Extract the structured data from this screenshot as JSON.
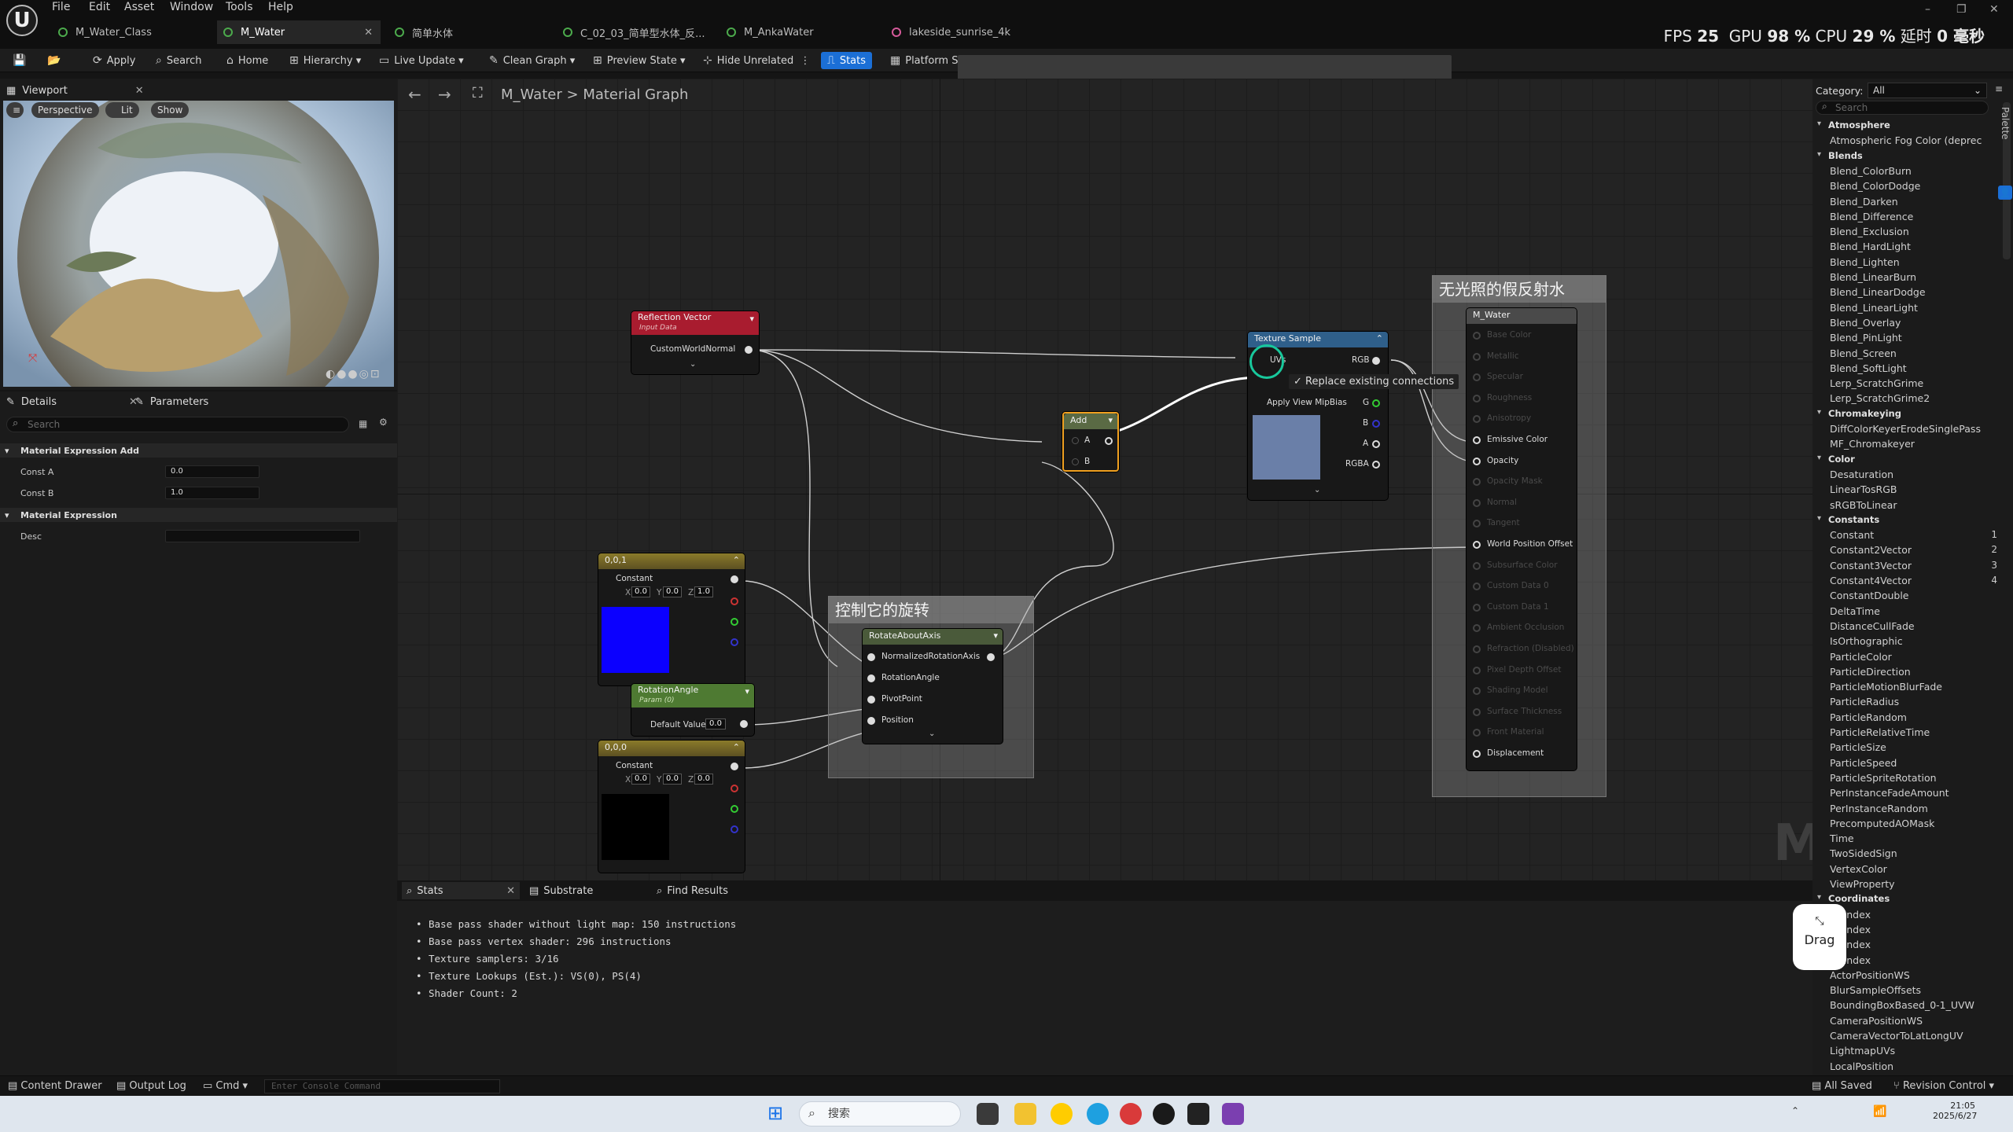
{
  "menu": [
    "File",
    "Edit",
    "Asset",
    "Window",
    "Tools",
    "Help"
  ],
  "tabs": [
    {
      "label": "M_Water_Class",
      "icon": "material-icon"
    },
    {
      "label": "M_Water",
      "icon": "material-icon",
      "active": true
    },
    {
      "label": "简单水体",
      "icon": "material-icon"
    },
    {
      "label": "C_02_03_简单型水体_反...",
      "icon": "material-icon"
    },
    {
      "label": "M_AnkaWater",
      "icon": "material-icon"
    },
    {
      "label": "lakeside_sunrise_4k",
      "icon": "texture-icon"
    }
  ],
  "perf": {
    "fps_label": "FPS",
    "fps": "25",
    "gpu_label": "GPU",
    "gpu": "98 %",
    "cpu_label": "CPU",
    "cpu": "29 %",
    "lat_label": "延时",
    "lat": "0 毫秒"
  },
  "toolbar": {
    "apply": "Apply",
    "search": "Search",
    "home": "Home",
    "hierarchy": "Hierarchy",
    "live_update": "Live Update",
    "clean_graph": "Clean Graph",
    "preview_state": "Preview State",
    "hide_unrelated": "Hide Unrelated",
    "stats": "Stats",
    "platform_stats": "Platform S"
  },
  "viewport": {
    "tab": "Viewport",
    "perspective": "Perspective",
    "lit": "Lit",
    "show": "Show"
  },
  "details": {
    "tab": "Details",
    "params_tab": "Parameters",
    "search_placeholder": "Search",
    "section1": "Material Expression Add",
    "const_a_label": "Const A",
    "const_a": "0.0",
    "const_b_label": "Const B",
    "const_b": "1.0",
    "section2": "Material Expression",
    "desc_label": "Desc"
  },
  "breadcrumb": {
    "root": "M_Water",
    "sep": ">",
    "leaf": "Material Graph"
  },
  "nodes": {
    "reflection": {
      "title": "Reflection Vector",
      "sub": "Input Data",
      "out": "CustomWorldNormal"
    },
    "add": {
      "title": "Add",
      "a": "A",
      "b": "B"
    },
    "texture": {
      "title": "Texture Sample",
      "uvs": "UVs",
      "rgb": "RGB",
      "g": "G",
      "b": "B",
      "a": "A",
      "rgba": "RGBA",
      "mip": "Apply View MipBias",
      "tooltip": "Replace existing connections"
    },
    "const001": {
      "title": "0,0,1",
      "label": "Constant",
      "x": "0.0",
      "y": "0.0",
      "z": "1.0",
      "color": "#0b00ff"
    },
    "rotangle": {
      "title": "RotationAngle",
      "sub": "Param (0)",
      "label": "Default Value",
      "val": "0.0"
    },
    "const000": {
      "title": "0,0,0",
      "label": "Constant",
      "x": "0.0",
      "y": "0.0",
      "z": "0.0",
      "color": "#000000"
    },
    "rotate": {
      "title": "RotateAboutAxis",
      "pins": [
        "NormalizedRotationAxis",
        "RotationAngle",
        "PivotPoint",
        "Position"
      ]
    }
  },
  "comments": {
    "rotation": "控制它的旋转",
    "unlit": "无光照的假反射水"
  },
  "result": {
    "title": "M_Water",
    "pins": [
      {
        "label": "Base Color",
        "active": false
      },
      {
        "label": "Metallic",
        "active": false
      },
      {
        "label": "Specular",
        "active": false
      },
      {
        "label": "Roughness",
        "active": false
      },
      {
        "label": "Anisotropy",
        "active": false
      },
      {
        "label": "Emissive Color",
        "active": true
      },
      {
        "label": "Opacity",
        "active": true
      },
      {
        "label": "Opacity Mask",
        "active": false
      },
      {
        "label": "Normal",
        "active": false
      },
      {
        "label": "Tangent",
        "active": false
      },
      {
        "label": "World Position Offset",
        "active": true
      },
      {
        "label": "Subsurface Color",
        "active": false
      },
      {
        "label": "Custom Data 0",
        "active": false
      },
      {
        "label": "Custom Data 1",
        "active": false
      },
      {
        "label": "Ambient Occlusion",
        "active": false
      },
      {
        "label": "Refraction (Disabled)",
        "active": false
      },
      {
        "label": "Pixel Depth Offset",
        "active": false
      },
      {
        "label": "Shading Model",
        "active": false
      },
      {
        "label": "Surface Thickness",
        "active": false
      },
      {
        "label": "Front Material",
        "active": false
      },
      {
        "label": "Displacement",
        "active": true
      }
    ]
  },
  "watermark": "M",
  "palette": {
    "category_label": "Category:",
    "category": "All",
    "search_placeholder": "Search",
    "side_tab": "Palette",
    "rows": [
      {
        "t": "c",
        "text": "Atmosphere"
      },
      {
        "t": "i",
        "text": "Atmospheric Fog Color (deprec"
      },
      {
        "t": "c",
        "text": "Blends"
      },
      {
        "t": "i",
        "text": "Blend_ColorBurn"
      },
      {
        "t": "i",
        "text": "Blend_ColorDodge"
      },
      {
        "t": "i",
        "text": "Blend_Darken"
      },
      {
        "t": "i",
        "text": "Blend_Difference"
      },
      {
        "t": "i",
        "text": "Blend_Exclusion"
      },
      {
        "t": "i",
        "text": "Blend_HardLight"
      },
      {
        "t": "i",
        "text": "Blend_Lighten"
      },
      {
        "t": "i",
        "text": "Blend_LinearBurn"
      },
      {
        "t": "i",
        "text": "Blend_LinearDodge"
      },
      {
        "t": "i",
        "text": "Blend_LinearLight"
      },
      {
        "t": "i",
        "text": "Blend_Overlay"
      },
      {
        "t": "i",
        "text": "Blend_PinLight"
      },
      {
        "t": "i",
        "text": "Blend_Screen"
      },
      {
        "t": "i",
        "text": "Blend_SoftLight"
      },
      {
        "t": "i",
        "text": "Lerp_ScratchGrime"
      },
      {
        "t": "i",
        "text": "Lerp_ScratchGrime2"
      },
      {
        "t": "c",
        "text": "Chromakeying"
      },
      {
        "t": "i",
        "text": "DiffColorKeyerErodeSinglePass"
      },
      {
        "t": "i",
        "text": "MF_Chromakeyer"
      },
      {
        "t": "c",
        "text": "Color"
      },
      {
        "t": "i",
        "text": "Desaturation"
      },
      {
        "t": "i",
        "text": "LinearTosRGB"
      },
      {
        "t": "i",
        "text": "sRGBToLinear"
      },
      {
        "t": "c",
        "text": "Constants"
      },
      {
        "t": "i",
        "text": "Constant",
        "n": "1"
      },
      {
        "t": "i",
        "text": "Constant2Vector",
        "n": "2"
      },
      {
        "t": "i",
        "text": "Constant3Vector",
        "n": "3"
      },
      {
        "t": "i",
        "text": "Constant4Vector",
        "n": "4"
      },
      {
        "t": "i",
        "text": "ConstantDouble"
      },
      {
        "t": "i",
        "text": "DeltaTime"
      },
      {
        "t": "i",
        "text": "DistanceCullFade"
      },
      {
        "t": "i",
        "text": "IsOrthographic"
      },
      {
        "t": "i",
        "text": "ParticleColor"
      },
      {
        "t": "i",
        "text": "ParticleDirection"
      },
      {
        "t": "i",
        "text": "ParticleMotionBlurFade"
      },
      {
        "t": "i",
        "text": "ParticleRadius"
      },
      {
        "t": "i",
        "text": "ParticleRandom"
      },
      {
        "t": "i",
        "text": "ParticleRelativeTime"
      },
      {
        "t": "i",
        "text": "ParticleSize"
      },
      {
        "t": "i",
        "text": "ParticleSpeed"
      },
      {
        "t": "i",
        "text": "ParticleSpriteRotation"
      },
      {
        "t": "i",
        "text": "PerInstanceFadeAmount"
      },
      {
        "t": "i",
        "text": "PerInstanceRandom"
      },
      {
        "t": "i",
        "text": "PrecomputedAOMask"
      },
      {
        "t": "i",
        "text": "Time"
      },
      {
        "t": "i",
        "text": "TwoSidedSign"
      },
      {
        "t": "i",
        "text": "VertexColor"
      },
      {
        "t": "i",
        "text": "ViewProperty"
      },
      {
        "t": "c",
        "text": "Coordinates"
      },
      {
        "t": "i",
        "text": "1DIndex"
      },
      {
        "t": "i",
        "text": "2DIndex"
      },
      {
        "t": "i",
        "text": "3DIndex"
      },
      {
        "t": "i",
        "text": "4DIndex"
      },
      {
        "t": "i",
        "text": "ActorPositionWS"
      },
      {
        "t": "i",
        "text": "BlurSampleOffsets"
      },
      {
        "t": "i",
        "text": "BoundingBoxBased_0-1_UVW"
      },
      {
        "t": "i",
        "text": "CameraPositionWS"
      },
      {
        "t": "i",
        "text": "CameraVectorToLatLongUV"
      },
      {
        "t": "i",
        "text": "LightmapUVs"
      },
      {
        "t": "i",
        "text": "LocalPosition"
      }
    ]
  },
  "stats": {
    "tab": "Stats",
    "substrate": "Substrate",
    "find": "Find Results",
    "lines": [
      "Base pass shader without light map: 150 instructions",
      "Base pass vertex shader: 296 instructions",
      "Texture samplers: 3/16",
      "Texture Lookups (Est.): VS(0), PS(4)",
      "Shader Count: 2"
    ]
  },
  "drag": "Drag",
  "statusbar": {
    "content_drawer": "Content Drawer",
    "output_log": "Output Log",
    "cmd": "Cmd",
    "console_placeholder": "Enter Console Command",
    "saved": "All Saved",
    "revision": "Revision Control"
  },
  "taskbar": {
    "search": "搜索",
    "time": "21:05",
    "date": "2025/6/27"
  }
}
